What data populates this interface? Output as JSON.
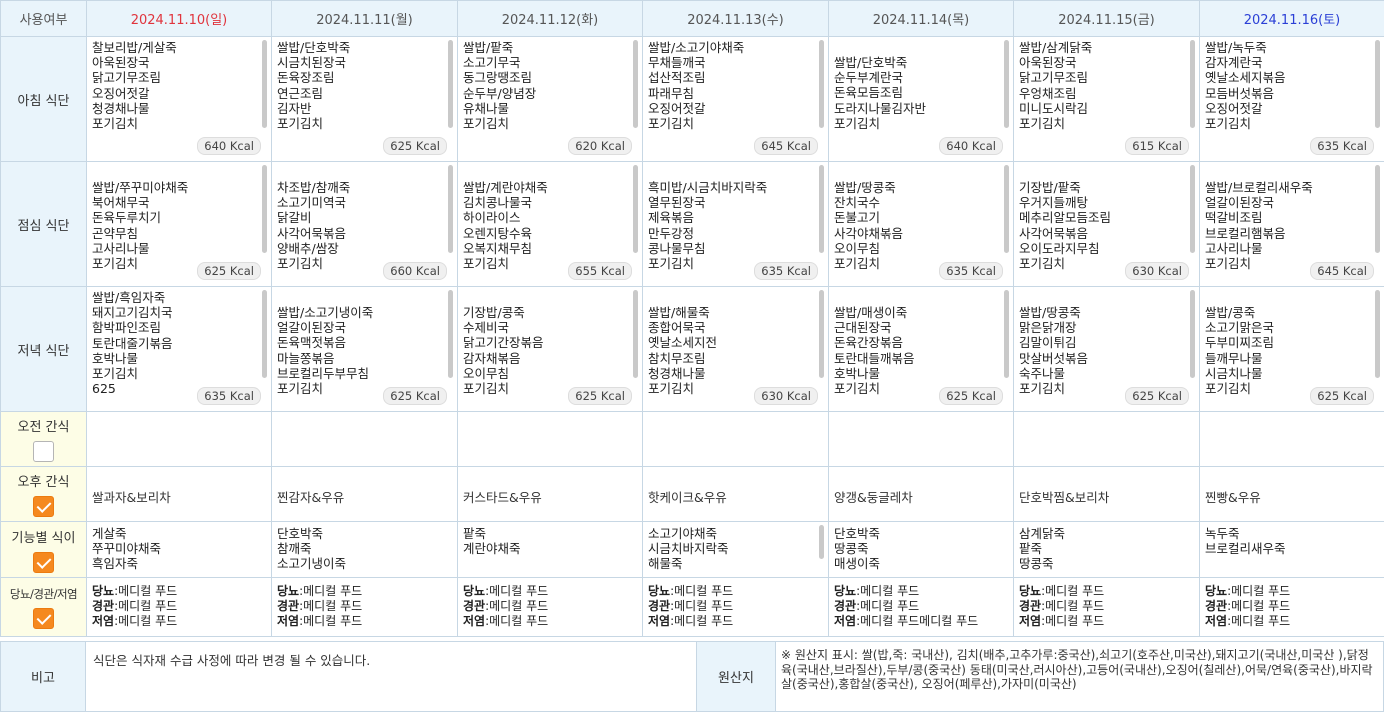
{
  "header": {
    "usage_label": "사용여부",
    "dates": [
      "2024.11.10(일)",
      "2024.11.11(월)",
      "2024.11.12(화)",
      "2024.11.13(수)",
      "2024.11.14(목)",
      "2024.11.15(금)",
      "2024.11.16(토)"
    ]
  },
  "rows": {
    "breakfast": "아침 식단",
    "lunch": "점심 식단",
    "dinner": "저녁 식단",
    "snack_am": "오전 간식",
    "snack_pm": "오후 간식",
    "functional": "기능별 식이",
    "diet": "당뇨/경관/저염"
  },
  "checkboxes": {
    "snack_am": false,
    "snack_pm": true,
    "functional": true,
    "diet": true
  },
  "breakfast": [
    {
      "menu": "찰보리밥/게살죽\n아욱된장국\n닭고기무조림\n오징어젓갈\n청경채나물\n포기김치",
      "kcal": "640 Kcal"
    },
    {
      "menu": "쌀밥/단호박죽\n시금치된장국\n돈육장조림\n연근조림\n김자반\n포기김치",
      "kcal": "625 Kcal"
    },
    {
      "menu": "쌀밥/팥죽\n소고기무국\n동그랑땡조림\n순두부/양념장\n유채나물\n포기김치",
      "kcal": "620 Kcal"
    },
    {
      "menu": "쌀밥/소고기야채죽\n무채들깨국\n섭산적조림\n파래무침\n오징어젓갈\n포기김치",
      "kcal": "645 Kcal"
    },
    {
      "menu": "쌀밥/단호박죽\n순두부계란국\n돈육모듬조림\n도라지나물김자반\n포기김치",
      "kcal": "640 Kcal"
    },
    {
      "menu": "쌀밥/삼계닭죽\n아욱된장국\n닭고기무조림\n우엉채조림\n미니도시락김\n포기김치",
      "kcal": "615 Kcal"
    },
    {
      "menu": "쌀밥/녹두죽\n감자계란국\n옛날소세지볶음\n모듬버섯볶음\n오징어젓갈\n포기김치",
      "kcal": "635 Kcal"
    }
  ],
  "lunch": [
    {
      "menu": "쌀밥/쭈꾸미야채죽\n북어채무국\n돈육두루치기\n곤약무침\n고사리나물\n포기김치",
      "kcal": "625 Kcal"
    },
    {
      "menu": "차조밥/참깨죽\n소고기미역국\n닭갈비\n사각어묵볶음\n양배추/쌈장\n포기김치",
      "kcal": "660 Kcal"
    },
    {
      "menu": "쌀밥/계란야채죽\n김치콩나물국\n하이라이스\n오렌지탕수육\n오복지채무침\n포기김치",
      "kcal": "655 Kcal"
    },
    {
      "menu": "흑미밥/시금치바지락죽\n열무된장국\n제육볶음\n만두강정\n콩나물무침\n포기김치",
      "kcal": "635 Kcal"
    },
    {
      "menu": "쌀밥/땅콩죽\n잔치국수\n돈불고기\n사각야채볶음\n오이무침\n포기김치",
      "kcal": "635 Kcal"
    },
    {
      "menu": "기장밥/팥죽\n우거지들깨탕\n메추리알모듬조림\n사각어묵볶음\n오이도라지무침\n포기김치",
      "kcal": "630 Kcal"
    },
    {
      "menu": "쌀밥/브로컬리새우죽\n얼갈이된장국\n떡갈비조림\n브로컬리햄볶음\n고사리나물\n포기김치",
      "kcal": "645 Kcal"
    }
  ],
  "dinner": [
    {
      "menu": "쌀밥/흑임자죽\n돼지고기김치국\n함박파인조림\n토란대줄기볶음\n호박나물\n포기김치\n625",
      "kcal": "635 Kcal"
    },
    {
      "menu": "쌀밥/소고기냉이죽\n얼갈이된장국\n돈육맥젓볶음\n마늘쫑볶음\n브로컬리두부무침\n포기김치",
      "kcal": "625 Kcal"
    },
    {
      "menu": "기장밥/콩죽\n수제비국\n닭고기간장볶음\n감자채볶음\n오이무침\n포기김치",
      "kcal": "625 Kcal"
    },
    {
      "menu": "쌀밥/해물죽\n종합어묵국\n옛날소세지전\n참치무조림\n청경채나물\n포기김치",
      "kcal": "630 Kcal"
    },
    {
      "menu": "쌀밥/매생이죽\n근대된장국\n돈육간장볶음\n토란대들깨볶음\n호박나물\n포기김치",
      "kcal": "625 Kcal"
    },
    {
      "menu": "쌀밥/땅콩죽\n맑은닭개장\n김말이튀김\n맛살버섯볶음\n숙주나물\n포기김치",
      "kcal": "625 Kcal"
    },
    {
      "menu": "쌀밥/콩죽\n소고기맑은국\n두부미찌조림\n들깨무나물\n시금치나물\n포기김치",
      "kcal": "625 Kcal"
    }
  ],
  "snack_pm": [
    "쌀과자&보리차",
    "찐감자&우유",
    "커스타드&우유",
    "핫케이크&우유",
    "양갱&둥글레차",
    "단호박찜&보리차",
    "찐빵&우유"
  ],
  "functional": [
    "게살죽\n쭈꾸미야채죽\n흑임자죽",
    "단호박죽\n참깨죽\n소고기냉이죽",
    "팥죽\n계란야채죽",
    "소고기야채죽\n시금치바지락죽\n해물죽",
    "단호박죽\n땅콩죽\n매생이죽",
    "삼계닭죽\n팥죽\n땅콩죽",
    "녹두죽\n브로컬리새우죽"
  ],
  "diet": {
    "labels": {
      "diabetic": "당뇨",
      "tube": "경관",
      "lowsalt": "저염"
    },
    "values": [
      {
        "diabetic": ":메디컬 푸드",
        "tube": ":메디컬 푸드",
        "lowsalt": ":메디컬 푸드"
      },
      {
        "diabetic": ":메디컬 푸드",
        "tube": ":메디컬 푸드",
        "lowsalt": ":메디컬 푸드"
      },
      {
        "diabetic": ":메디컬 푸드",
        "tube": ":메디컬 푸드",
        "lowsalt": ":메디컬 푸드"
      },
      {
        "diabetic": ":메디컬 푸드",
        "tube": ":메디컬 푸드",
        "lowsalt": ":메디컬 푸드"
      },
      {
        "diabetic": ":메디컬 푸드",
        "tube": ":메디컬 푸드",
        "lowsalt": ":메디컬 푸드메디컬 푸드"
      },
      {
        "diabetic": ":메디컬 푸드",
        "tube": ":메디컬 푸드",
        "lowsalt": ":메디컬 푸드"
      },
      {
        "diabetic": ":메디컬 푸드",
        "tube": ":메디컬 푸드",
        "lowsalt": ":메디컬 푸드"
      }
    ]
  },
  "note": {
    "label": "비고",
    "text": "식단은 식자재 수급 사정에 따라 변경 될 수 있습니다.",
    "origin_label": "원산지",
    "origin_text": "※ 원산지 표시: 쌀(밥,죽: 국내산), 김치(배추,고추가루:중국산),쇠고기(호주산,미국산),돼지고기(국내산,미국산 ),닭정육(국내산,브라질산),두부/콩(중국산) 동태(미국산,러시아산),고등어(국내산),오징어(칠레산),어묵/연육(중국산),바지락살(중국산),홍합살(중국산), 오징어(페루산),가자미(미국산)"
  },
  "colors": {
    "checkbox_on": "#f5891f",
    "sunday": "#e0343d",
    "saturday": "#2a3fd6",
    "header_bg": "#e9f4fb"
  }
}
